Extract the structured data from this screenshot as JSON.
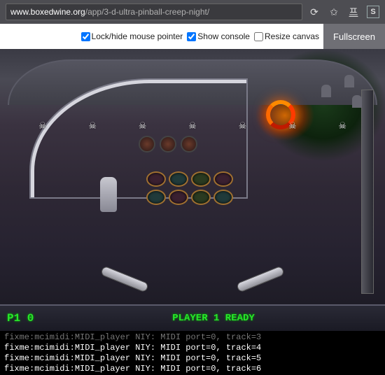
{
  "browser": {
    "url_host": "www.boxedwine.org",
    "url_path": "/app/3-d-ultra-pinball-creep-night/"
  },
  "controls": {
    "lock_pointer": {
      "label": "Lock/hide mouse pointer",
      "checked": true
    },
    "show_console": {
      "label": "Show console",
      "checked": true
    },
    "resize_canvas": {
      "label": "Resize canvas",
      "checked": false
    },
    "fullscreen_label": "Fullscreen"
  },
  "game_status": {
    "score_display": "P1 0",
    "message": "PLAYER 1 READY"
  },
  "console_lines": [
    "fixme:mcimidi:MIDI_player NIY: MIDI port=0, track=3",
    "fixme:mcimidi:MIDI_player NIY: MIDI port=0, track=4",
    "fixme:mcimidi:MIDI_player NIY: MIDI port=0, track=5",
    "fixme:mcimidi:MIDI_player NIY: MIDI port=0, track=6"
  ]
}
